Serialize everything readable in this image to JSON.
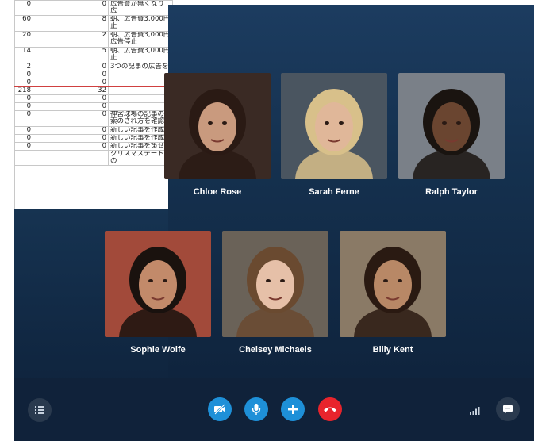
{
  "spreadsheet": {
    "rows": [
      {
        "a": "0",
        "b": "0",
        "c": "広告費が無くなり広"
      },
      {
        "a": "60",
        "b": "8",
        "c": "朝、広告費3,000円\n止"
      },
      {
        "a": "20",
        "b": "2",
        "c": "朝、広告費3,000円\n広告停止"
      },
      {
        "a": "14",
        "b": "5",
        "c": "朝、広告費3,000円\n止"
      },
      {
        "a": "2",
        "b": "0",
        "c": "3つの記事の広告を"
      },
      {
        "a": "0",
        "b": "0",
        "c": ""
      },
      {
        "a": "0",
        "b": "0",
        "c": ""
      },
      {
        "a": "218",
        "b": "32",
        "c": ""
      },
      {
        "a": "0",
        "b": "0",
        "c": ""
      },
      {
        "a": "0",
        "b": "0",
        "c": ""
      },
      {
        "a": "0",
        "b": "0",
        "c": "神宮球場の記事の\n索のされ方を確認"
      },
      {
        "a": "0",
        "b": "0",
        "c": "新しい記事を作成"
      },
      {
        "a": "0",
        "b": "0",
        "c": "新しい記事を作成"
      },
      {
        "a": "0",
        "b": "0",
        "c": "新しい記事を策せ"
      },
      {
        "a": "",
        "b": "",
        "c": "クリスマスデートの"
      }
    ]
  },
  "call": {
    "participants": [
      {
        "name": "Chloe Rose",
        "bg": "#3a2a24",
        "skin": "#c99a7e",
        "hair": "#2a1a14"
      },
      {
        "name": "Sarah Ferne",
        "bg": "#4a5560",
        "skin": "#e0b799",
        "hair": "#d8c08a"
      },
      {
        "name": "Ralph Taylor",
        "bg": "#7a8088",
        "skin": "#6a4530",
        "hair": "#1a1410"
      },
      {
        "name": "Sophie Wolfe",
        "bg": "#a24a3a",
        "skin": "#c28a6a",
        "hair": "#1a120e"
      },
      {
        "name": "Chelsey Michaels",
        "bg": "#6a6258",
        "skin": "#e6c0a8",
        "hair": "#6a4a30"
      },
      {
        "name": "Billy Kent",
        "bg": "#8a7a66",
        "skin": "#b88866",
        "hair": "#2a1a12"
      }
    ],
    "controls": {
      "menu_icon": "list-icon",
      "video_icon": "video-off-icon",
      "mic_icon": "microphone-icon",
      "add_icon": "plus-icon",
      "end_icon": "end-call-icon",
      "signal_icon": "signal-icon",
      "chat_icon": "chat-icon",
      "accent": "#1e90d8",
      "end_color": "#e8242c"
    }
  }
}
